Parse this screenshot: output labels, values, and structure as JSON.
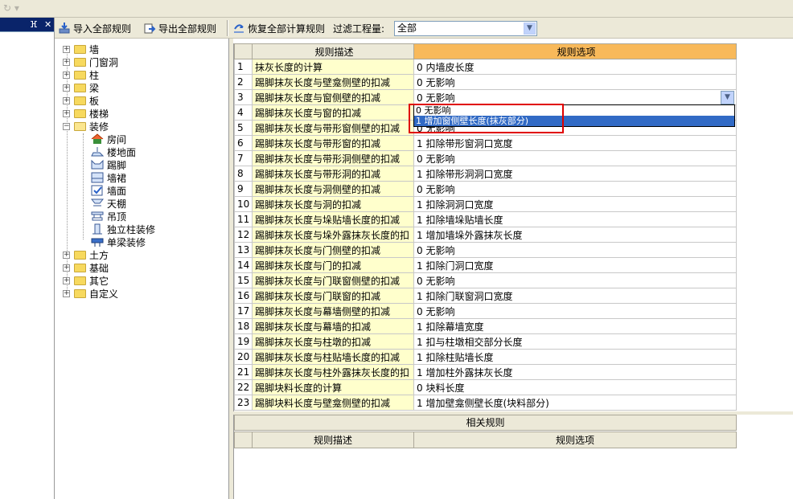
{
  "topbar": {
    "ghost": "↻ ▾"
  },
  "leftpanel": {
    "pin": "ⴼ",
    "close": "✕"
  },
  "toolbar": {
    "import_label": "导入全部规则",
    "export_label": "导出全部规则",
    "restore_label": "恢复全部计算规则",
    "filter_label": "过滤工程量:",
    "filter_value": "全部"
  },
  "tree": {
    "items": [
      {
        "label": "墙"
      },
      {
        "label": "门窗洞"
      },
      {
        "label": "柱"
      },
      {
        "label": "梁"
      },
      {
        "label": "板"
      },
      {
        "label": "楼梯"
      },
      {
        "label": "装修"
      },
      {
        "label": "房间"
      },
      {
        "label": "楼地面"
      },
      {
        "label": "踢脚"
      },
      {
        "label": "墙裙"
      },
      {
        "label": "墙面"
      },
      {
        "label": "天棚"
      },
      {
        "label": "吊顶"
      },
      {
        "label": "独立柱装修"
      },
      {
        "label": "单梁装修"
      },
      {
        "label": "土方"
      },
      {
        "label": "基础"
      },
      {
        "label": "其它"
      },
      {
        "label": "自定义"
      }
    ]
  },
  "grid": {
    "col_desc": "规则描述",
    "col_opt": "规则选项",
    "rows": [
      {
        "n": "1",
        "desc": "抹灰长度的计算",
        "opt": "0 内墙皮长度"
      },
      {
        "n": "2",
        "desc": "踢脚抹灰长度与壁龛侧壁的扣减",
        "opt": "0  无影响"
      },
      {
        "n": "3",
        "desc": "踢脚抹灰长度与窗侧壁的扣减",
        "opt": "0  无影响"
      },
      {
        "n": "4",
        "desc": "踢脚抹灰长度与窗的扣减",
        "opt": ""
      },
      {
        "n": "5",
        "desc": "踢脚抹灰长度与带形窗侧壁的扣减",
        "opt": "0  无影响"
      },
      {
        "n": "6",
        "desc": "踢脚抹灰长度与带形窗的扣减",
        "opt": "1 扣除带形窗洞口宽度"
      },
      {
        "n": "7",
        "desc": "踢脚抹灰长度与带形洞侧壁的扣减",
        "opt": "0  无影响"
      },
      {
        "n": "8",
        "desc": "踢脚抹灰长度与带形洞的扣减",
        "opt": "1 扣除带形洞洞口宽度"
      },
      {
        "n": "9",
        "desc": "踢脚抹灰长度与洞侧壁的扣减",
        "opt": "0  无影响"
      },
      {
        "n": "10",
        "desc": "踢脚抹灰长度与洞的扣减",
        "opt": "1 扣除洞洞口宽度"
      },
      {
        "n": "11",
        "desc": "踢脚抹灰长度与垛贴墙长度的扣减",
        "opt": "1 扣除墙垛贴墙长度"
      },
      {
        "n": "12",
        "desc": "踢脚抹灰长度与垛外露抹灰长度的扣",
        "opt": "1 增加墙垛外露抹灰长度"
      },
      {
        "n": "13",
        "desc": "踢脚抹灰长度与门侧壁的扣减",
        "opt": "0  无影响"
      },
      {
        "n": "14",
        "desc": "踢脚抹灰长度与门的扣减",
        "opt": "1 扣除门洞口宽度"
      },
      {
        "n": "15",
        "desc": "踢脚抹灰长度与门联窗侧壁的扣减",
        "opt": "0  无影响"
      },
      {
        "n": "16",
        "desc": "踢脚抹灰长度与门联窗的扣减",
        "opt": "1 扣除门联窗洞口宽度"
      },
      {
        "n": "17",
        "desc": "踢脚抹灰长度与幕墙侧壁的扣减",
        "opt": "0  无影响"
      },
      {
        "n": "18",
        "desc": "踢脚抹灰长度与幕墙的扣减",
        "opt": "1 扣除幕墙宽度"
      },
      {
        "n": "19",
        "desc": "踢脚抹灰长度与柱墩的扣减",
        "opt": "1 扣与柱墩相交部分长度"
      },
      {
        "n": "20",
        "desc": "踢脚抹灰长度与柱贴墙长度的扣减",
        "opt": "1 扣除柱贴墙长度"
      },
      {
        "n": "21",
        "desc": "踢脚抹灰长度与柱外露抹灰长度的扣",
        "opt": "1 增加柱外露抹灰长度"
      },
      {
        "n": "22",
        "desc": "踢脚块料长度的计算",
        "opt": "0 块料长度"
      },
      {
        "n": "23",
        "desc": "踢脚块料长度与壁龛侧壁的扣减",
        "opt": "1 增加壁龛侧壁长度(块料部分)"
      }
    ]
  },
  "dropdown": {
    "options": [
      "0  无影响",
      "1 增加窗侧壁长度(抹灰部分)"
    ],
    "selected_index": 1
  },
  "related": {
    "title": "相关规则",
    "col_desc": "规则描述",
    "col_opt": "规则选项"
  },
  "colors": {
    "header_accent": "#f8b95a",
    "desc_bg": "#ffffcc",
    "selection": "#316ac5",
    "highlight_box": "#e00000"
  }
}
